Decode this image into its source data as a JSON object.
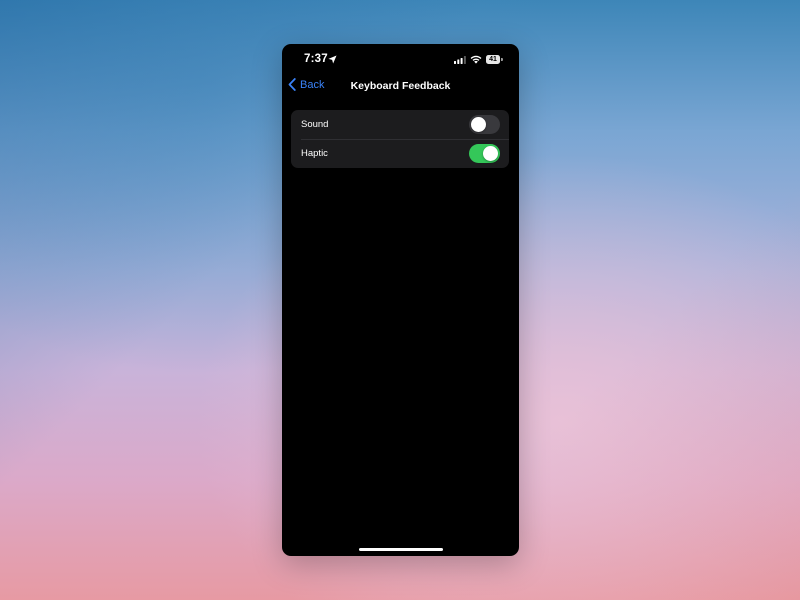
{
  "status_bar": {
    "time": "7:37",
    "battery": "41"
  },
  "nav": {
    "back_label": "Back",
    "title": "Keyboard Feedback"
  },
  "settings": [
    {
      "label": "Sound",
      "enabled": false
    },
    {
      "label": "Haptic",
      "enabled": true
    }
  ],
  "colors": {
    "accent": "#3a82f7",
    "toggle_on": "#34c759",
    "toggle_off": "#39393d",
    "group_background": "#1c1c1e"
  },
  "icons": {
    "location": "location-arrow-icon",
    "signal": "cellular-signal-icon",
    "wifi": "wifi-icon",
    "battery": "battery-icon",
    "back": "chevron-left-icon"
  }
}
